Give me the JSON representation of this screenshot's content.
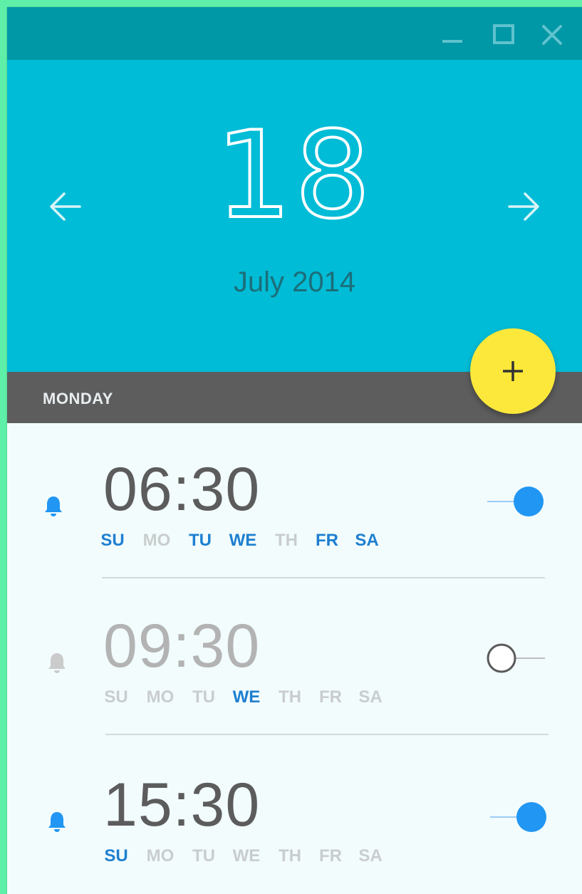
{
  "window_controls": {
    "minimize_icon": "minimize-icon",
    "maximize_icon": "maximize-icon",
    "close_icon": "close-icon"
  },
  "header": {
    "day": "18",
    "month_year": "July 2014",
    "prev_icon": "arrow-left-icon",
    "next_icon": "arrow-right-icon"
  },
  "day_band": {
    "label": "MONDAY"
  },
  "fab": {
    "icon": "plus-icon"
  },
  "colors": {
    "titlebar": "#0097a6",
    "header": "#00bcd6",
    "band": "#5d5d5d",
    "fab": "#fce83a",
    "accent": "#2196f3",
    "active_day": "#1e7fd0",
    "inactive_day": "#c9cdce",
    "active_time": "#5c5c5c",
    "inactive_time": "#b3b3b3"
  },
  "alarms": [
    {
      "time": "06:30",
      "enabled": true,
      "days": [
        {
          "label": "SU",
          "active": true
        },
        {
          "label": "MO",
          "active": false
        },
        {
          "label": "TU",
          "active": true
        },
        {
          "label": "WE",
          "active": true
        },
        {
          "label": "TH",
          "active": false
        },
        {
          "label": "FR",
          "active": true
        },
        {
          "label": "SA",
          "active": true
        }
      ]
    },
    {
      "time": "09:30",
      "enabled": false,
      "days": [
        {
          "label": "SU",
          "active": false
        },
        {
          "label": "MO",
          "active": false
        },
        {
          "label": "TU",
          "active": false
        },
        {
          "label": "WE",
          "active": true
        },
        {
          "label": "TH",
          "active": false
        },
        {
          "label": "FR",
          "active": false
        },
        {
          "label": "SA",
          "active": false
        }
      ]
    },
    {
      "time": "15:30",
      "enabled": true,
      "days": [
        {
          "label": "SU",
          "active": true
        },
        {
          "label": "MO",
          "active": false
        },
        {
          "label": "TU",
          "active": false
        },
        {
          "label": "WE",
          "active": false
        },
        {
          "label": "TH",
          "active": false
        },
        {
          "label": "FR",
          "active": false
        },
        {
          "label": "SA",
          "active": false
        }
      ]
    }
  ]
}
